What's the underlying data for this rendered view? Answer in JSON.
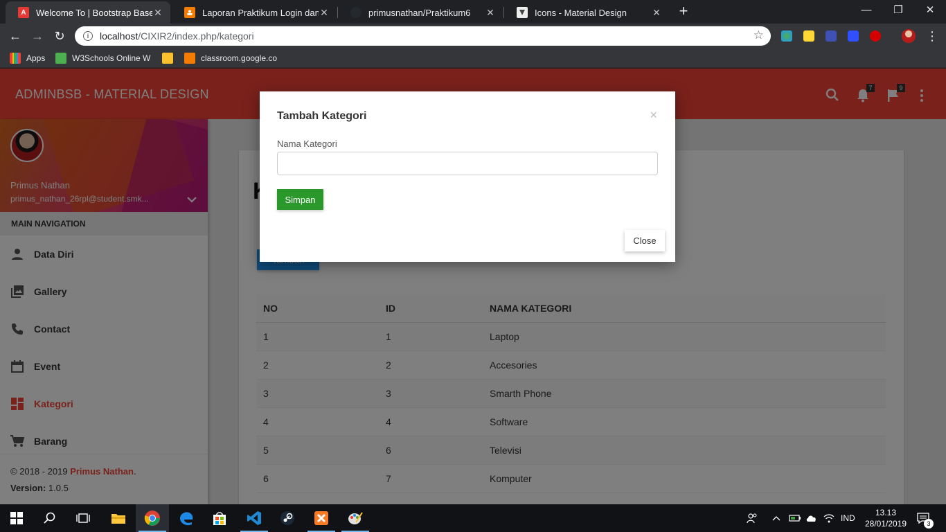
{
  "browser": {
    "tabs": [
      {
        "title": "Welcome To | Bootstrap Based Ac",
        "favicon_color": "#e53935",
        "favicon_letter": "A",
        "active": true
      },
      {
        "title": "Laporan Praktikum Login dan CR",
        "favicon_color": "#f57c00",
        "favicon_letter": "",
        "active": false
      },
      {
        "title": "primusnathan/Praktikum6",
        "favicon_color": "#24292e",
        "favicon_letter": "",
        "active": false
      },
      {
        "title": "Icons - Material Design",
        "favicon_color": "#eeeeee",
        "favicon_letter": "",
        "active": false
      }
    ],
    "url_host": "localhost",
    "url_path": "/CIXIR2/index.php/kategori",
    "bookmarks": [
      {
        "label": "Apps",
        "icon_color": "#ea4335"
      },
      {
        "label": "W3Schools Online W",
        "icon_color": "#4caf50"
      },
      {
        "label": "",
        "icon_color": "#fbc02d"
      },
      {
        "label": "classroom.google.co",
        "icon_color": "#f57c00"
      }
    ]
  },
  "app": {
    "brand": "ADMINBSB - MATERIAL DESIGN",
    "accent": "#f44336",
    "notifications_count": "7",
    "tasks_count": "9"
  },
  "user": {
    "name": "Primus Nathan",
    "email": "primus_nathan_26rpl@student.smk..."
  },
  "sidebar": {
    "header": "MAIN NAVIGATION",
    "items": [
      {
        "label": "Data Diri",
        "icon": "person-icon",
        "active": false
      },
      {
        "label": "Gallery",
        "icon": "photo-library-icon",
        "active": false
      },
      {
        "label": "Contact",
        "icon": "phone-icon",
        "active": false
      },
      {
        "label": "Event",
        "icon": "calendar-icon",
        "active": false
      },
      {
        "label": "Kategori",
        "icon": "dashboard-icon",
        "active": true
      },
      {
        "label": "Barang",
        "icon": "cart-icon",
        "active": false
      }
    ],
    "copyright": "© 2018 - 2019 ",
    "owner": "Primus Nathan",
    "owner_suffix": ".",
    "version_label": "Version:",
    "version": " 1.0.5"
  },
  "main": {
    "title_initial": "K",
    "add_button": "Tambah",
    "table": {
      "headers": [
        "NO",
        "ID",
        "NAMA KATEGORI"
      ],
      "rows": [
        [
          "1",
          "1",
          "Laptop"
        ],
        [
          "2",
          "2",
          "Accesories"
        ],
        [
          "3",
          "3",
          "Smarth Phone"
        ],
        [
          "4",
          "4",
          "Software"
        ],
        [
          "5",
          "6",
          "Televisi"
        ],
        [
          "6",
          "7",
          "Komputer"
        ]
      ]
    }
  },
  "modal": {
    "title": "Tambah Kategori",
    "close_x": "×",
    "field_label": "Nama Kategori",
    "field_value": "",
    "field_placeholder": "",
    "save_label": "Simpan",
    "close_label": "Close"
  },
  "taskbar": {
    "time": "13.13",
    "date": "28/01/2019",
    "language": "IND",
    "notifications": "3"
  }
}
